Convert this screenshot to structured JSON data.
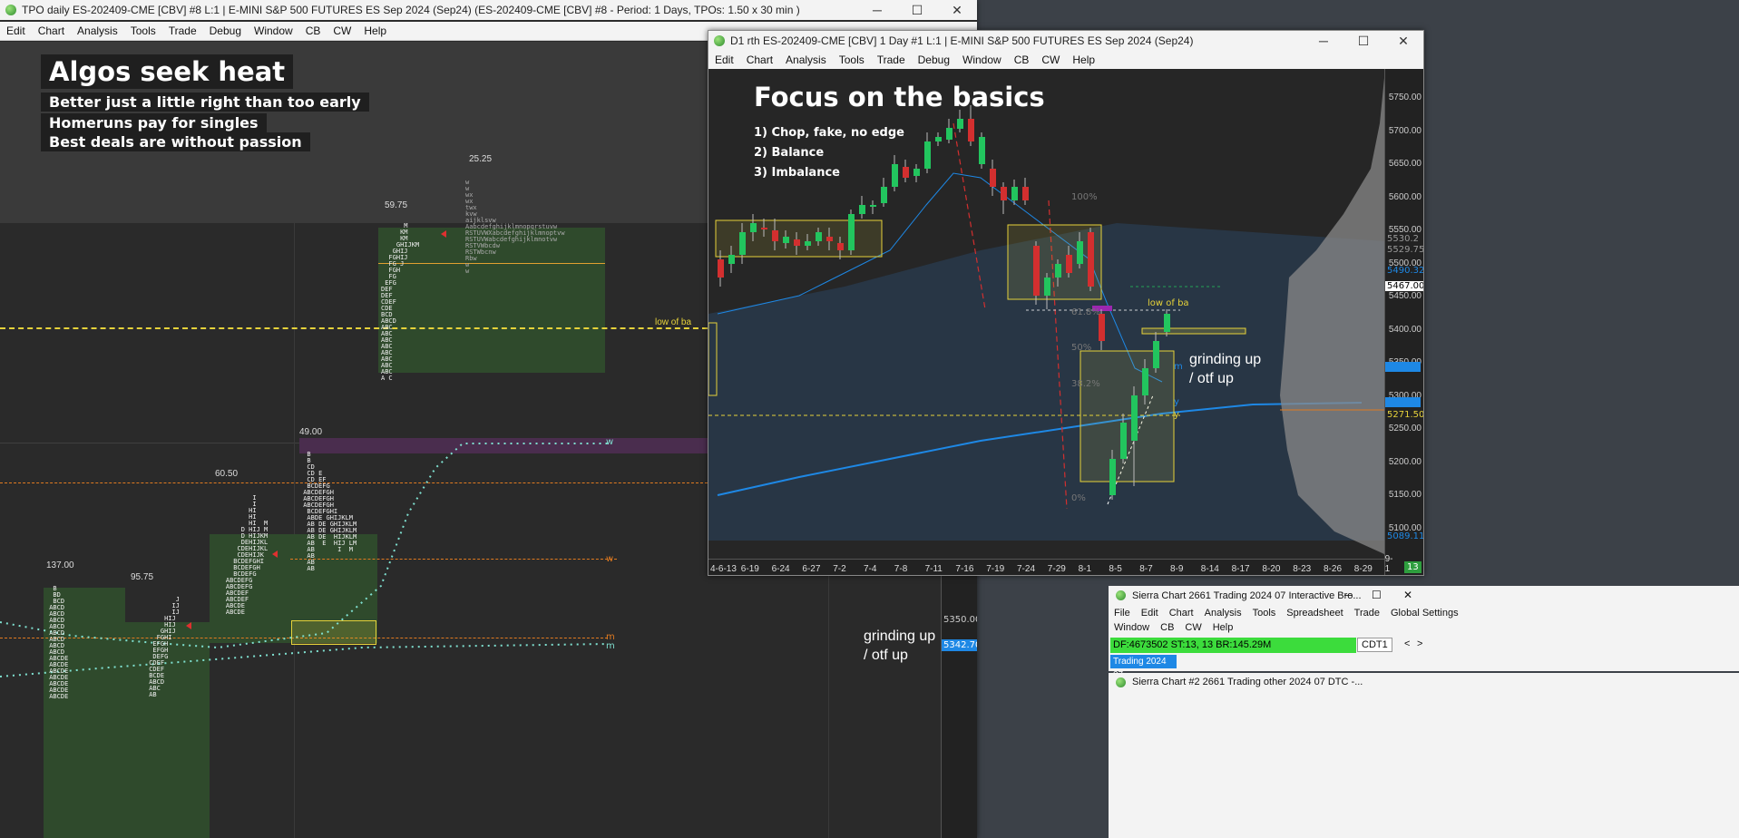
{
  "left_window": {
    "title": "TPO daily ES-202409-CME [CBV] #8 L:1 | E-MINI S&P 500 FUTURES ES Sep 2024 (Sep24) (ES-202409-CME [CBV] #8 - Period: 1 Days, TPOs: 1.50 x 30 min )",
    "menu": [
      "Edit",
      "Chart",
      "Analysis",
      "Tools",
      "Trade",
      "Debug",
      "Window",
      "CB",
      "CW",
      "Help"
    ],
    "heading": "Algos seek heat",
    "notes": [
      "Better just a little right than too early",
      "Homeruns pay for singles",
      "Best deals are without passion"
    ],
    "labels": {
      "v2525": "25.25",
      "v5975": "59.75",
      "v4900": "49.00",
      "v6050": "60.50",
      "v13700": "137.00",
      "v9575": "95.75",
      "low_of_ba": "low of ba",
      "w1": "w",
      "w2": "w",
      "m": "m",
      "m2": "m"
    },
    "annotation": [
      "grinding up",
      "/ otf up"
    ],
    "price_labels": {
      "p5350": "5350.00",
      "p5342": "5342.70"
    }
  },
  "right_window": {
    "title": "D1 rth ES-202409-CME [CBV]  1 Day  #1 L:1 | E-MINI S&P 500 FUTURES ES Sep 2024 (Sep24)",
    "menu": [
      "Edit",
      "Chart",
      "Analysis",
      "Tools",
      "Trade",
      "Debug",
      "Window",
      "CB",
      "CW",
      "Help"
    ],
    "heading": "Focus on the basics",
    "list": [
      "1)  Chop, fake, no edge",
      "2)  Balance",
      "3)  Imbalance"
    ],
    "annotation": [
      "grinding up",
      "/ otf up"
    ],
    "low_of_ba": "low of ba",
    "fib": {
      "f100": "100%",
      "f618": "61.8%",
      "f50": "50%",
      "f382": "38.2%",
      "f0": "0%"
    },
    "price_axis": [
      "5750.00",
      "5700.00",
      "5650.00",
      "5600.00",
      "5550.00",
      "5500.00",
      "5450.00",
      "5400.00",
      "5350.00",
      "5300.00",
      "5250.00",
      "5200.00",
      "5150.00",
      "5100.00"
    ],
    "price_tags": {
      "t5530": "5530.2",
      "t5529": "5529.75",
      "t5490": "5490.32",
      "t5467": "5467.00",
      "t5340": "5340.0",
      "t5290": "5290.0",
      "t5271": "5271.50",
      "t5089": "5089.11"
    },
    "date_axis": [
      "4-6-13",
      "6-19",
      "6-24",
      "6-27",
      "7-2",
      "7-4",
      "7-8",
      "7-11",
      "7-16",
      "7-19",
      "7-24",
      "7-29",
      "8-1",
      "8-5",
      "8-7",
      "8-9",
      "8-14",
      "8-17",
      "8-20",
      "8-23",
      "8-26",
      "8-29",
      "9-1"
    ],
    "corner_badge": "13",
    "markers": {
      "m": "m",
      "y1": "y",
      "y2": "y"
    }
  },
  "sierra_small": {
    "title": "Sierra Chart 2661 Trading 2024 07 Interactive Bro...",
    "menu1": [
      "File",
      "Edit",
      "Chart",
      "Analysis",
      "Tools",
      "Spreadsheet",
      "Trade",
      "Global Settings"
    ],
    "menu2": [
      "Window",
      "CB",
      "CW",
      "Help"
    ],
    "status": "DF:4673502  ST:13, 13  BR:145.29M",
    "cdt": "CDT1",
    "tab": "Trading 2024 07",
    "title2": "Sierra Chart #2 2661 Trading other 2024 07 DTC -..."
  },
  "colors": {
    "accent_green": "#22c55e",
    "bear_red": "#d32f2f",
    "vwap_blue": "#1e88e5",
    "yellow": "#e6d23a"
  }
}
